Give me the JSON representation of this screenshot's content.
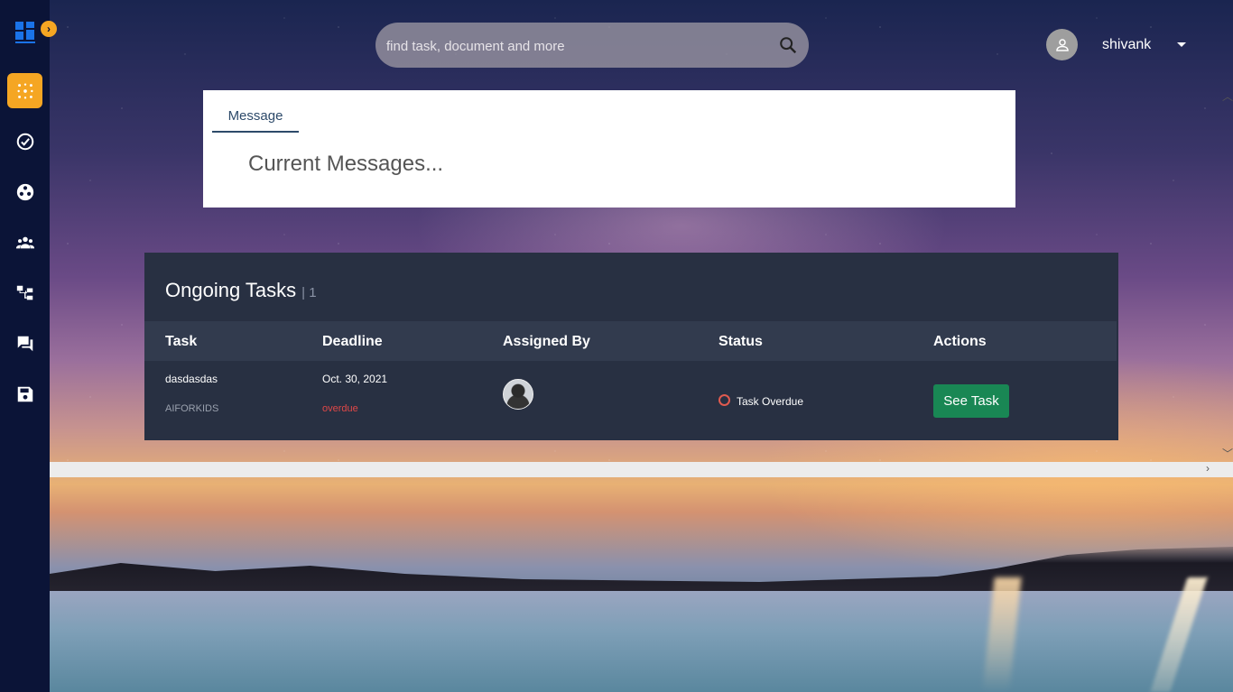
{
  "search": {
    "placeholder": "find task, document and more"
  },
  "user": {
    "name": "shivank"
  },
  "sidebar": {
    "items": [
      {
        "name": "dashboard",
        "icon": "dashboard-icon",
        "active": true
      },
      {
        "name": "tasks",
        "icon": "check-circle-icon"
      },
      {
        "name": "groups",
        "icon": "network-icon"
      },
      {
        "name": "people",
        "icon": "people-icon"
      },
      {
        "name": "hierarchy",
        "icon": "hierarchy-icon"
      },
      {
        "name": "messages",
        "icon": "chat-icon"
      },
      {
        "name": "saved",
        "icon": "save-icon"
      }
    ]
  },
  "message_card": {
    "tab_label": "Message",
    "current_text": "Current Messages..."
  },
  "tasks": {
    "title": "Ongoing Tasks",
    "count": "| 1",
    "headers": {
      "task": "Task",
      "deadline": "Deadline",
      "assigned_by": "Assigned By",
      "status": "Status",
      "actions": "Actions"
    },
    "rows": [
      {
        "task": "dasdasdas",
        "org": "AIFORKIDS",
        "deadline": "Oct. 30, 2021",
        "deadline_state": "overdue",
        "status": "Task Overdue",
        "action": "See Task"
      }
    ]
  },
  "colors": {
    "accent": "#f5a623",
    "sidebar": "#0b1437",
    "panel": "#283042",
    "success": "#198754",
    "danger": "#e04848"
  }
}
